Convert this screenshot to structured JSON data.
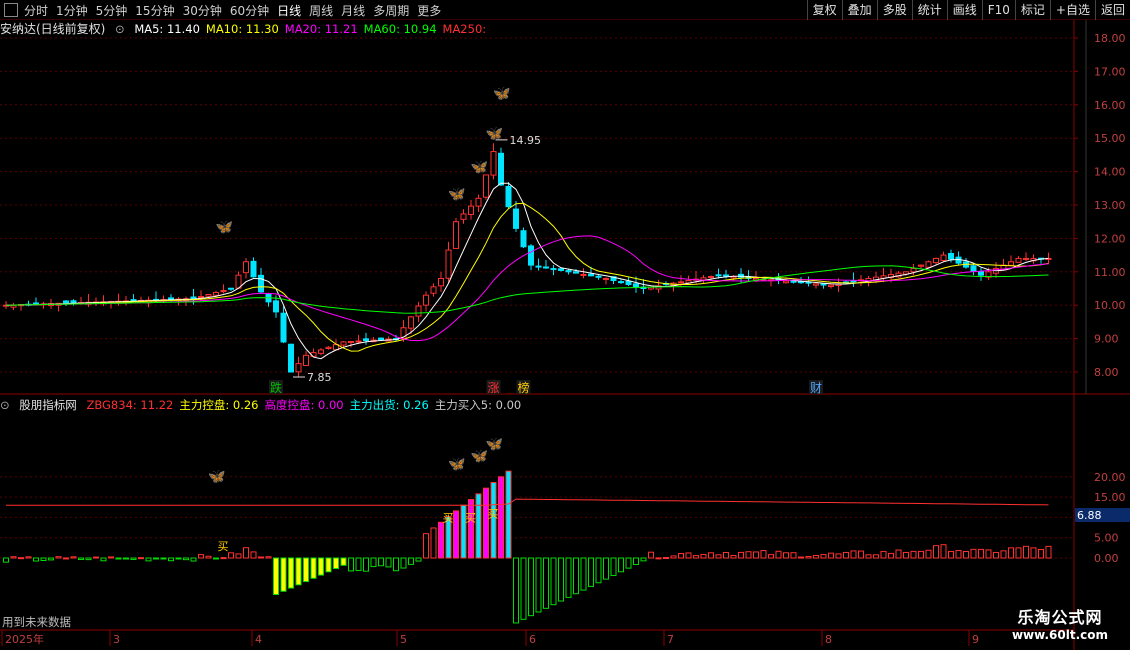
{
  "toolbar": {
    "periods": [
      "分时",
      "1分钟",
      "5分钟",
      "15分钟",
      "30分钟",
      "60分钟",
      "日线",
      "周线",
      "月线",
      "多周期",
      "更多"
    ],
    "active_period": "日线",
    "right_buttons": [
      "复权",
      "叠加",
      "多股",
      "统计",
      "画线",
      "F10",
      "标记",
      "+自选",
      "返回"
    ]
  },
  "main": {
    "title": "安纳达(日线前复权)",
    "ma": [
      {
        "label": "MA5: 11.40",
        "color": "#ffffff"
      },
      {
        "label": "MA10: 11.30",
        "color": "#ffff00"
      },
      {
        "label": "MA20: 11.21",
        "color": "#ff00ff"
      },
      {
        "label": "MA60: 10.94",
        "color": "#00ff00"
      },
      {
        "label": "MA250:",
        "color": "#ff3030"
      }
    ],
    "price_ticks": [
      "18.00",
      "17.00",
      "16.00",
      "15.00",
      "14.00",
      "13.00",
      "12.00",
      "11.00",
      "10.00",
      "9.00",
      "8.00"
    ],
    "high_label": "14.95",
    "low_label": "7.85",
    "markers": [
      {
        "text": "跌",
        "color": "#00c000"
      },
      {
        "text": "涨",
        "color": "#ff3030"
      },
      {
        "text": "榜",
        "color": "#ffcc00"
      },
      {
        "text": "财",
        "color": "#4da6ff"
      }
    ]
  },
  "indicator": {
    "title": "股朋指标网",
    "values": [
      {
        "label": "ZBG834: 11.22",
        "color": "#ff3030"
      },
      {
        "label": "主力控盘: 0.26",
        "color": "#ffff00"
      },
      {
        "label": "高度控盘: 0.00",
        "color": "#ff00ff"
      },
      {
        "label": "主力出货: 0.26",
        "color": "#00ffff"
      },
      {
        "label": "主力买入5: 0.00",
        "color": "#c8c8c8"
      }
    ],
    "ticks": [
      "20.00",
      "15.00",
      "10.00",
      "5.00",
      "0.00"
    ],
    "current_value": "6.88",
    "buy_text": "买"
  },
  "bottom": {
    "future_text": "用到未来数据",
    "months": [
      "2025年",
      "3",
      "4",
      "5",
      "6",
      "7",
      "8",
      "9"
    ]
  },
  "watermark": {
    "title": "乐淘公式网",
    "url": "www.60lt.com"
  }
}
